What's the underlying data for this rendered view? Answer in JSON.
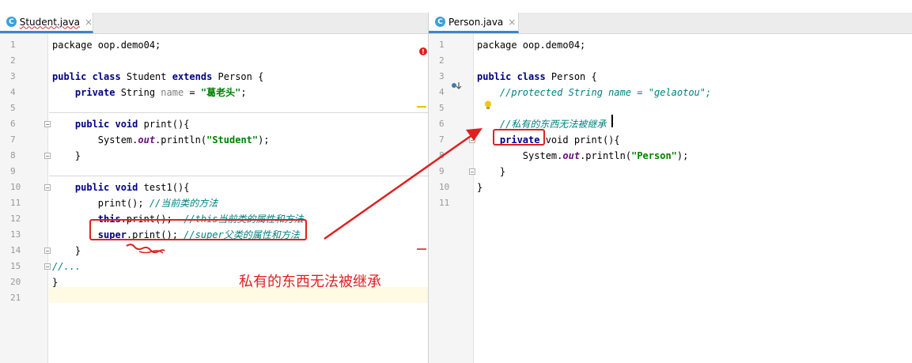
{
  "left": {
    "tab": {
      "icon": "class-icon",
      "icon_letter": "C",
      "name": "Student.java",
      "close": "×"
    },
    "lines": [
      {
        "num": "1",
        "parts": [
          {
            "t": "package oop.demo04;",
            "c": ""
          }
        ]
      },
      {
        "num": "2",
        "parts": []
      },
      {
        "num": "3",
        "parts": [
          {
            "t": "public class",
            "c": "kw"
          },
          {
            "t": " Student ",
            "c": ""
          },
          {
            "t": "extends",
            "c": "kw"
          },
          {
            "t": " Person {",
            "c": ""
          }
        ]
      },
      {
        "num": "4",
        "parts": [
          {
            "t": "    ",
            "c": ""
          },
          {
            "t": "private",
            "c": "kw"
          },
          {
            "t": " String ",
            "c": ""
          },
          {
            "t": "name",
            "c": "uname"
          },
          {
            "t": " = ",
            "c": ""
          },
          {
            "t": "\"葛老头\"",
            "c": "str"
          },
          {
            "t": ";",
            "c": ""
          }
        ]
      },
      {
        "num": "5",
        "parts": []
      },
      {
        "num": "6",
        "parts": [
          {
            "t": "    ",
            "c": ""
          },
          {
            "t": "public void",
            "c": "kw"
          },
          {
            "t": " print(){",
            "c": ""
          }
        ]
      },
      {
        "num": "7",
        "parts": [
          {
            "t": "        System.",
            "c": ""
          },
          {
            "t": "out",
            "c": "fld"
          },
          {
            "t": ".println(",
            "c": ""
          },
          {
            "t": "\"Student\"",
            "c": "str"
          },
          {
            "t": ");",
            "c": ""
          }
        ]
      },
      {
        "num": "8",
        "parts": [
          {
            "t": "    }",
            "c": ""
          }
        ]
      },
      {
        "num": "9",
        "parts": []
      },
      {
        "num": "10",
        "parts": [
          {
            "t": "    ",
            "c": ""
          },
          {
            "t": "public void",
            "c": "kw"
          },
          {
            "t": " test1(){",
            "c": ""
          }
        ]
      },
      {
        "num": "11",
        "parts": [
          {
            "t": "        print(); ",
            "c": ""
          },
          {
            "t": "//当前类的方法",
            "c": "cmt"
          }
        ]
      },
      {
        "num": "12",
        "parts": [
          {
            "t": "        ",
            "c": ""
          },
          {
            "t": "this",
            "c": "kw"
          },
          {
            "t": ".print();  ",
            "c": ""
          },
          {
            "t": "//this当前类的属性和方法",
            "c": "cmt"
          }
        ]
      },
      {
        "num": "13",
        "parts": [
          {
            "t": "        ",
            "c": ""
          },
          {
            "t": "super",
            "c": "kw"
          },
          {
            "t": ".print(); ",
            "c": ""
          },
          {
            "t": "//super父类的属性和方法",
            "c": "cmt"
          }
        ]
      },
      {
        "num": "14",
        "parts": [
          {
            "t": "    }",
            "c": ""
          }
        ]
      },
      {
        "num": "15",
        "parts": [
          {
            "t": "//...",
            "c": "cmt"
          }
        ]
      },
      {
        "num": "20",
        "parts": [
          {
            "t": "}",
            "c": ""
          }
        ]
      },
      {
        "num": "21",
        "parts": []
      }
    ],
    "error_icon": "!"
  },
  "right": {
    "tab": {
      "icon": "class-icon",
      "icon_letter": "C",
      "name": "Person.java",
      "close": "×"
    },
    "lines": [
      {
        "num": "1",
        "parts": [
          {
            "t": "package oop.demo04;",
            "c": ""
          }
        ]
      },
      {
        "num": "2",
        "parts": []
      },
      {
        "num": "3",
        "parts": [
          {
            "t": "public class",
            "c": "kw"
          },
          {
            "t": " Person {",
            "c": ""
          }
        ]
      },
      {
        "num": "4",
        "parts": [
          {
            "t": "    ",
            "c": ""
          },
          {
            "t": "//protected String name = \"gelaotou\";",
            "c": "cmt"
          }
        ]
      },
      {
        "num": "5",
        "parts": []
      },
      {
        "num": "6",
        "parts": [
          {
            "t": "    ",
            "c": ""
          },
          {
            "t": "//私有的东西无法被继承",
            "c": "cmt"
          }
        ]
      },
      {
        "num": "7",
        "parts": [
          {
            "t": "    ",
            "c": ""
          },
          {
            "t": "private",
            "c": "kw"
          },
          {
            "t": " void print(){",
            "c": ""
          }
        ]
      },
      {
        "num": "8",
        "parts": [
          {
            "t": "        System.",
            "c": ""
          },
          {
            "t": "out",
            "c": "fld"
          },
          {
            "t": ".println(",
            "c": ""
          },
          {
            "t": "\"Person\"",
            "c": "str"
          },
          {
            "t": ");",
            "c": ""
          }
        ]
      },
      {
        "num": "9",
        "parts": [
          {
            "t": "    }",
            "c": ""
          }
        ]
      },
      {
        "num": "10",
        "parts": [
          {
            "t": "}",
            "c": ""
          }
        ]
      },
      {
        "num": "11",
        "parts": []
      }
    ]
  },
  "annotation": {
    "text": "私有的东西无法被继承"
  },
  "colors": {
    "annotation": "#e02020",
    "keyword": "#000080",
    "string": "#008000",
    "comment": "#008080"
  }
}
